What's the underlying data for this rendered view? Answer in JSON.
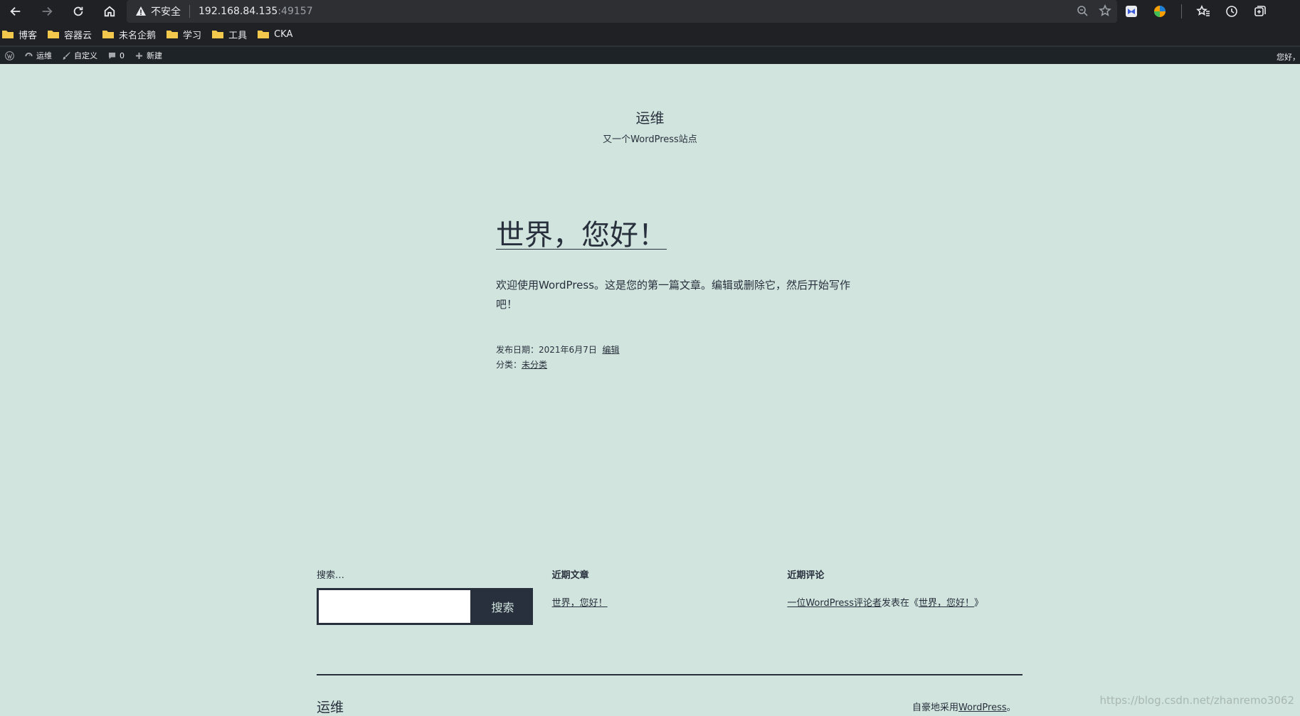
{
  "browser": {
    "security_label": "不安全",
    "url_host": "192.168.84.135",
    "url_port": ":49157"
  },
  "bookmarks": [
    {
      "label": "博客"
    },
    {
      "label": "容器云"
    },
    {
      "label": "未名企鹅"
    },
    {
      "label": "学习"
    },
    {
      "label": "工具"
    },
    {
      "label": "CKA"
    }
  ],
  "adminbar": {
    "site_name": "运维",
    "customize": "自定义",
    "comments_count": "0",
    "new": "新建",
    "greeting": "您好，"
  },
  "site": {
    "title": "运维",
    "description": "又一个WordPress站点"
  },
  "post": {
    "title": "世界，您好！",
    "body": "欢迎使用WordPress。这是您的第一篇文章。编辑或删除它，然后开始写作吧！",
    "published_label": "发布日期：",
    "published_date": "2021年6月7日",
    "edit_link": "编辑",
    "category_label": "分类：",
    "category": "未分类"
  },
  "widgets": {
    "search_label": "搜索…",
    "search_button": "搜索",
    "recent_posts_title": "近期文章",
    "recent_post_link": "世界，您好！",
    "recent_comments_title": "近期评论",
    "comment_author": "一位WordPress评论者",
    "comment_on": "发表在《",
    "comment_post": "世界，您好！",
    "comment_close": "》"
  },
  "footer": {
    "site_title": "运维",
    "powered_prefix": "自豪地采用",
    "powered_link": "WordPress",
    "powered_suffix": "。"
  },
  "watermark": "https://blog.csdn.net/zhanremo3062",
  "colors": {
    "page_bg": "#d1e4dd",
    "text": "#28303d",
    "chrome_bg": "#202124",
    "adminbar_bg": "#1d2327"
  }
}
